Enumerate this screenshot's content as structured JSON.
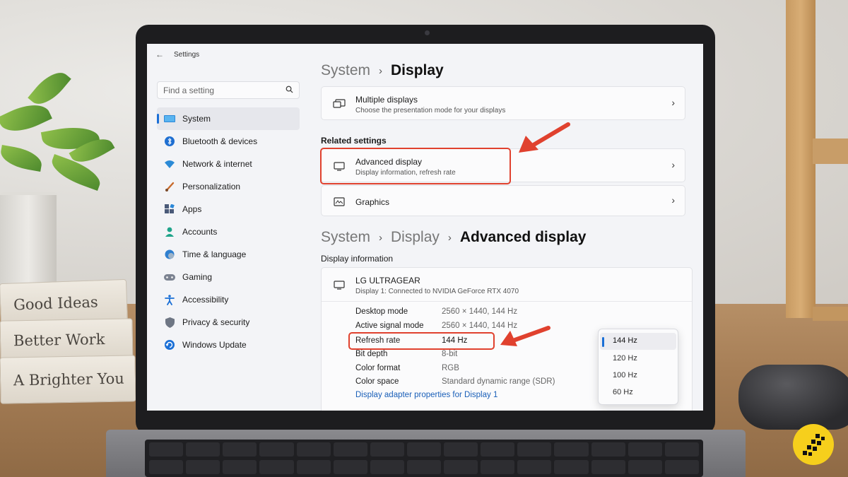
{
  "app": {
    "title": "Settings",
    "back_glyph": "←"
  },
  "search": {
    "placeholder": "Find a setting"
  },
  "sidebar": {
    "items": [
      {
        "label": "System",
        "icon": "monitor-icon",
        "active": true
      },
      {
        "label": "Bluetooth & devices",
        "icon": "bluetooth-icon"
      },
      {
        "label": "Network & internet",
        "icon": "wifi-icon"
      },
      {
        "label": "Personalization",
        "icon": "brush-icon"
      },
      {
        "label": "Apps",
        "icon": "apps-icon"
      },
      {
        "label": "Accounts",
        "icon": "person-icon"
      },
      {
        "label": "Time & language",
        "icon": "globe-clock-icon"
      },
      {
        "label": "Gaming",
        "icon": "gamepad-icon"
      },
      {
        "label": "Accessibility",
        "icon": "accessibility-icon"
      },
      {
        "label": "Privacy & security",
        "icon": "shield-icon"
      },
      {
        "label": "Windows Update",
        "icon": "update-icon"
      }
    ]
  },
  "breadcrumb1": {
    "parent": "System",
    "sep": "›",
    "current": "Display"
  },
  "multiple_displays": {
    "title": "Multiple displays",
    "subtitle": "Choose the presentation mode for your displays"
  },
  "related_settings": {
    "heading": "Related settings",
    "advanced_display": {
      "title": "Advanced display",
      "subtitle": "Display information, refresh rate"
    },
    "graphics": {
      "title": "Graphics"
    }
  },
  "breadcrumb2": {
    "root": "System",
    "parent": "Display",
    "sep": "›",
    "current": "Advanced display"
  },
  "display_info": {
    "heading": "Display information",
    "monitor_name": "LG ULTRAGEAR",
    "monitor_sub": "Display 1: Connected to NVIDIA GeForce RTX 4070",
    "rows": [
      {
        "label": "Desktop mode",
        "value": "2560 × 1440, 144 Hz"
      },
      {
        "label": "Active signal mode",
        "value": "2560 × 1440, 144 Hz"
      },
      {
        "label": "Refresh rate",
        "value": "144 Hz"
      },
      {
        "label": "Bit depth",
        "value": "8-bit"
      },
      {
        "label": "Color format",
        "value": "RGB"
      },
      {
        "label": "Color space",
        "value": "Standard dynamic range (SDR)"
      }
    ],
    "adapter_link": "Display adapter properties for Display 1"
  },
  "refresh_dropdown": {
    "options": [
      "144 Hz",
      "120 Hz",
      "100 Hz",
      "60 Hz"
    ],
    "selected": "144 Hz"
  },
  "books": [
    "Good Ideas",
    "Better Work",
    "A Brighter You"
  ],
  "colors": {
    "accent": "#1a6fd6",
    "highlight": "#e0412e",
    "link": "#1a5fb8",
    "badge": "#f6cf1c"
  }
}
